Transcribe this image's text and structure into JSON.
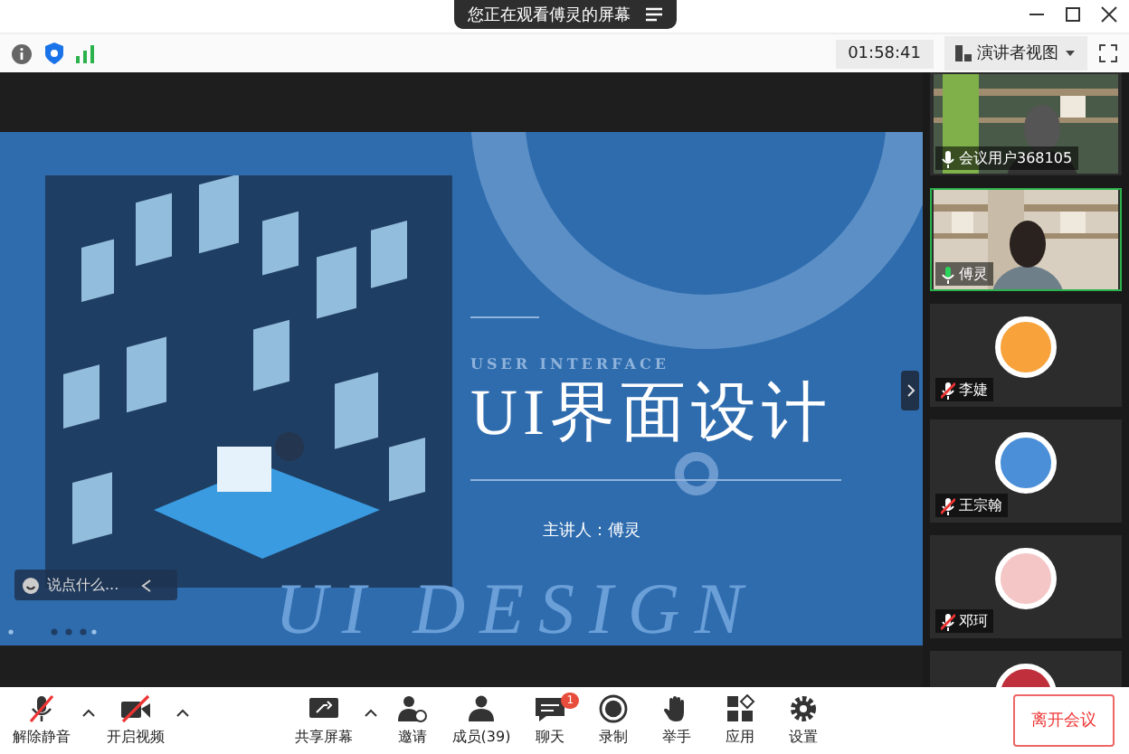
{
  "banner": {
    "text": "您正在观看傅灵的屏幕"
  },
  "info_bar": {
    "timer": "01:58:41",
    "view_button": "演讲者视图"
  },
  "slide": {
    "subtitle": "USER INTERFACE",
    "title": "UI界面设计",
    "presenter": "主讲人：傅灵",
    "watermark": "UI DESIGN"
  },
  "chat_input": {
    "placeholder": "说点什么..."
  },
  "participants": [
    {
      "kind": "video",
      "name": "会议用户368105",
      "muted": false,
      "speaking": false
    },
    {
      "kind": "video",
      "name": "傅灵",
      "muted": false,
      "speaking": true
    },
    {
      "kind": "avatar",
      "name": "李婕",
      "muted": true,
      "speaking": false
    },
    {
      "kind": "avatar",
      "name": "王宗翰",
      "muted": true,
      "speaking": false
    },
    {
      "kind": "avatar",
      "name": "邓珂",
      "muted": true,
      "speaking": false
    },
    {
      "kind": "avatar",
      "speaking": false
    }
  ],
  "toolbar": [
    {
      "kind": "mic_off",
      "label": "解除静音",
      "caret": true
    },
    {
      "kind": "video_off",
      "label": "开启视频",
      "caret": true
    },
    {
      "kind": "share",
      "label": "共享屏幕",
      "caret": true
    },
    {
      "kind": "invite",
      "label": "邀请"
    },
    {
      "kind": "members",
      "label": "成员(39)"
    },
    {
      "kind": "chat",
      "label": "聊天",
      "badge": "1"
    },
    {
      "kind": "record",
      "label": "录制"
    },
    {
      "kind": "hand",
      "label": "举手"
    },
    {
      "kind": "apps",
      "label": "应用"
    },
    {
      "kind": "settings",
      "label": "设置"
    }
  ],
  "leave_button": "离开会议"
}
